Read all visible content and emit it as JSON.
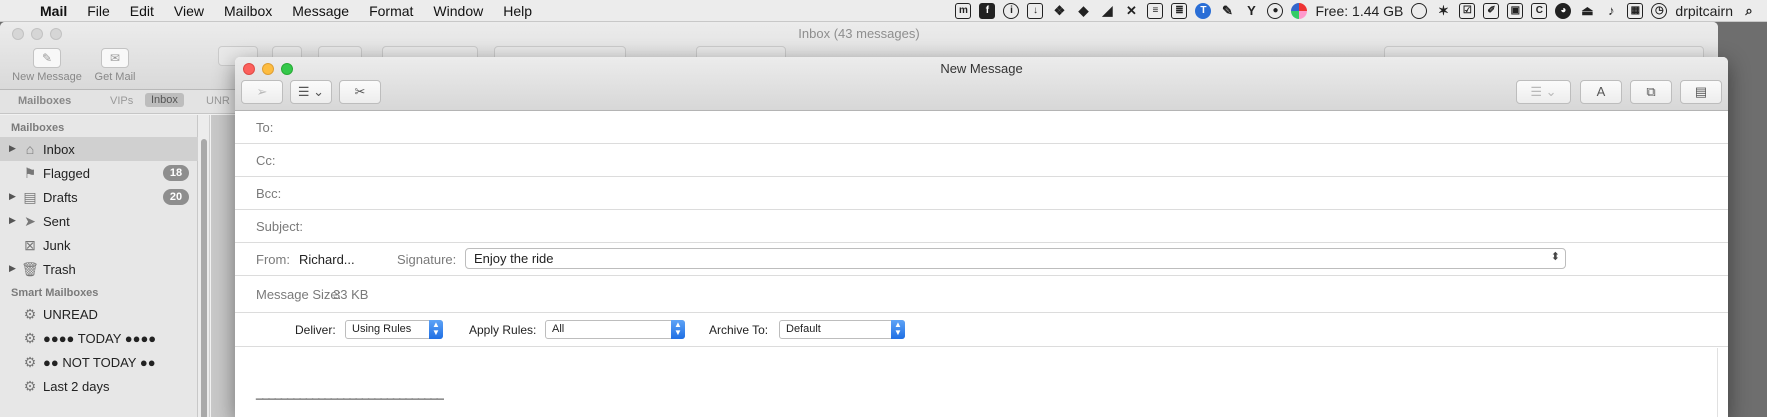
{
  "menubar": {
    "app_name": "Mail",
    "menus": [
      "File",
      "Edit",
      "View",
      "Mailbox",
      "Message",
      "Format",
      "Window",
      "Help"
    ],
    "memory": "Free: 1.44 GB",
    "user": "drpitcairn"
  },
  "mail_window": {
    "title": "Inbox (43 messages)",
    "toolbar": {
      "new_message": "New Message",
      "get_mail": "Get Mail"
    },
    "favorites": {
      "mailboxes": "Mailboxes",
      "vips": "VIPs",
      "inbox": "Inbox",
      "unread": "UNR"
    },
    "sidebar": {
      "mailboxes_header": "Mailboxes",
      "items": [
        {
          "label": "Inbox",
          "icon": "inbox-icon"
        },
        {
          "label": "Flagged",
          "badge": "18",
          "icon": "flag-icon"
        },
        {
          "label": "Drafts",
          "badge": "20",
          "icon": "document-icon"
        },
        {
          "label": "Sent",
          "icon": "paper-plane-icon"
        },
        {
          "label": "Junk",
          "icon": "junk-tray-icon"
        },
        {
          "label": "Trash",
          "icon": "trash-icon"
        }
      ],
      "smart_header": "Smart Mailboxes",
      "smart_items": [
        {
          "label": "UNREAD",
          "icon": "gear-icon"
        },
        {
          "label": "●●●● TODAY ●●●●",
          "icon": "gear-icon"
        },
        {
          "label": "●● NOT TODAY ●●",
          "icon": "gear-icon"
        },
        {
          "label": "Last 2 days",
          "icon": "gear-icon"
        }
      ]
    }
  },
  "compose": {
    "title": "New Message",
    "to_label": "To:",
    "cc_label": "Cc:",
    "bcc_label": "Bcc:",
    "subject_label": "Subject:",
    "from_label": "From:",
    "from_value": "Richard...",
    "signature_label": "Signature:",
    "signature_value": "Enjoy the ride",
    "size_label": "Message Size:",
    "size_value": "33 KB",
    "deliver_label": "Deliver:",
    "deliver_value": "Using Rules",
    "apply_rules_label": "Apply Rules:",
    "apply_rules_value": "All",
    "archive_label": "Archive To:",
    "archive_value": "Default",
    "signature_line": "______________________________"
  }
}
